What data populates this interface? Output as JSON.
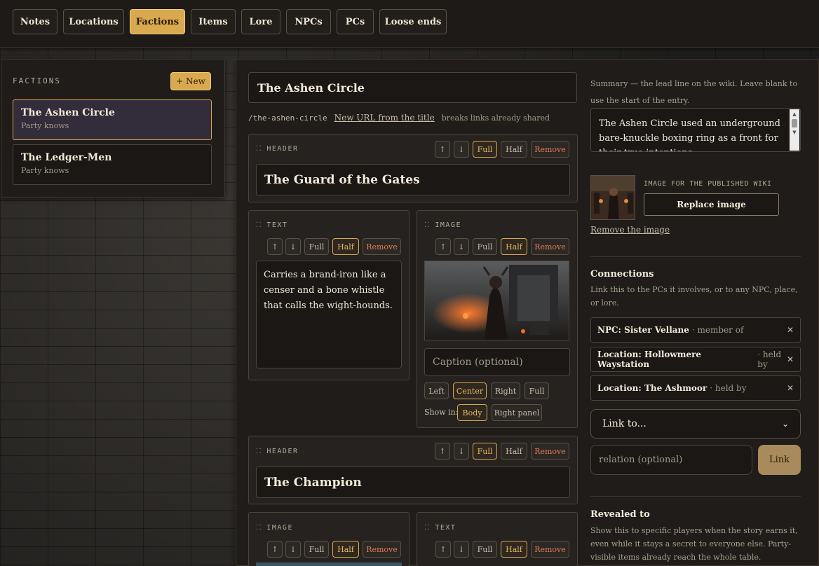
{
  "nav": {
    "tabs": [
      {
        "label": "Notes"
      },
      {
        "label": "Locations"
      },
      {
        "label": "Factions"
      },
      {
        "label": "Items"
      },
      {
        "label": "Lore"
      },
      {
        "label": "NPCs"
      },
      {
        "label": "PCs"
      },
      {
        "label": "Loose ends"
      }
    ],
    "active": "Factions"
  },
  "sidebar": {
    "title": "FACTIONS",
    "new_label": "+ New",
    "items": [
      {
        "name": "The Ashen Circle",
        "status": "Party knows"
      },
      {
        "name": "The Ledger-Men",
        "status": "Party knows"
      }
    ]
  },
  "editor": {
    "title_value": "The Ashen Circle",
    "slug": "/the-ashen-circle",
    "slug_link": "New URL from the title",
    "slug_note": "breaks links already shared",
    "buttons": {
      "up": "↑",
      "down": "↓",
      "full": "Full",
      "half": "Half",
      "remove": "Remove"
    },
    "header1": {
      "label": "HEADER",
      "text": "The Guard of the Gates"
    },
    "text1": {
      "label": "TEXT",
      "body": "Carries a brand-iron like a censer and a bone whistle that calls the wight-hounds."
    },
    "image1": {
      "label": "IMAGE",
      "caption_placeholder": "Caption (optional)",
      "align": [
        "Left",
        "Center",
        "Right",
        "Full"
      ],
      "align_selected": "Center",
      "show_in_label": "Show in:",
      "show_in": [
        "Body",
        "Right panel"
      ],
      "show_in_selected": "Body"
    },
    "header2": {
      "label": "HEADER",
      "text": "The Champion"
    },
    "image2": {
      "label": "IMAGE"
    },
    "text2": {
      "label": "TEXT"
    }
  },
  "right": {
    "summary_hint": "Summary — the lead line on the wiki. Leave blank to use the start of the entry.",
    "summary_text": "The Ashen Circle used an underground bare-knuckle boxing ring as a front for their true intentions.",
    "image_label": "IMAGE FOR THE PUBLISHED WIKI",
    "replace_label": "Replace image",
    "remove_label": "Remove the image",
    "connections_title": "Connections",
    "connections_hint": "Link this to the PCs it involves, or to any NPC, place, or lore.",
    "connections": [
      {
        "name": "NPC: Sister Vellane",
        "relation": "· member of"
      },
      {
        "name": "Location: Hollowmere Waystation",
        "relation": "· held by"
      },
      {
        "name": "Location: The Ashmoor",
        "relation": "· held by"
      }
    ],
    "link_select": "Link to...",
    "relation_placeholder": "relation (optional)",
    "link_button": "Link",
    "revealed_title": "Revealed to",
    "revealed_hint": "Show this to specific players when the story earns it, even while it stays a secret to everyone else. Party-visible items already reach the whole table."
  },
  "colors": {
    "accent": "#d8a94e",
    "remove": "#e07a57",
    "panel": "#1f1c19"
  }
}
